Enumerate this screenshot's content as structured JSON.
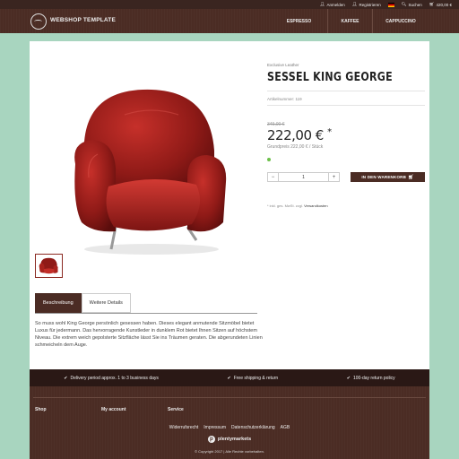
{
  "topbar": {
    "login": "Anmelden",
    "register": "Registrieren",
    "search": "Suchen",
    "cart_total": "420,00 €"
  },
  "header": {
    "brand": "WEBSHOP TEMPLATE",
    "nav": [
      "ESPRESSO",
      "KAFFEE",
      "CAPPUCCINO"
    ]
  },
  "product": {
    "category": "Exclusive Leather",
    "title": "SESSEL KING GEORGE",
    "article_no": "Artikelnummer: 119",
    "old_price": "349,00 €",
    "price": "222,00 €",
    "price_star": "*",
    "base_price": "Grundpreis 222,00 € / Stück",
    "quantity": "1",
    "cart_button": "IN DEN WARENKORB",
    "vat_text": "* inkl. ges. MwSt. zzgl.",
    "vat_link": "Versandkosten",
    "stock_color": "#6cc04a",
    "seat_color": "#9b1c1c"
  },
  "tabs": [
    "Beschreibung",
    "Weitere Details"
  ],
  "description": "So muss wohl King George persönlich gesessen haben. Dieses elegant anmutende Sitzmöbel bietet Luxus für jedermann. Das hervorragende Kunstleder in dunklem Rot bietet Ihnen Sitzen auf höchstem Niveau. Die extrem weich gepolsterte Sitzfläche lässt Sie ins Träumen geraten. Die abgerundeten Linien schmeicheln dem Auge.",
  "benefits": [
    "Delivery period approx. 1 to 3 business days",
    "Free shipping & return",
    "100-day return policy"
  ],
  "footer": {
    "columns": [
      "Shop",
      "My account",
      "Service"
    ],
    "links": [
      "Widerrufsrecht",
      "Impressum",
      "Datenschutzerklärung",
      "AGB"
    ],
    "brand": "plentymarkets",
    "copyright": "© Copyright 2017 | Alle Rechte vorbehalten."
  },
  "colors": {
    "brand_brown": "#4b2c24",
    "dark_strip": "#2a1815",
    "page_background": "#a8d5bf"
  }
}
